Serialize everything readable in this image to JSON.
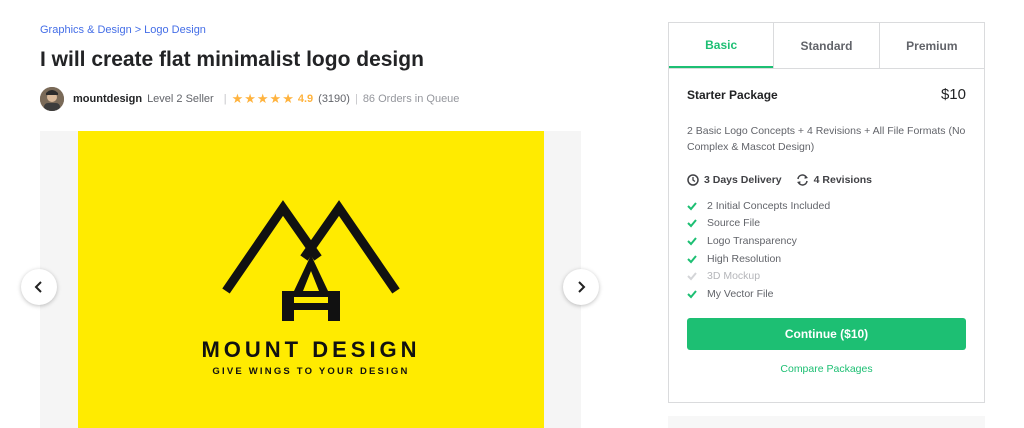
{
  "breadcrumb": {
    "category": "Graphics & Design",
    "separator": ">",
    "subcategory": "Logo Design"
  },
  "gig": {
    "title": "I will create flat minimalist logo design"
  },
  "seller": {
    "name": "mountdesign",
    "level": "Level 2 Seller",
    "rating": "4.9",
    "star_count": 5,
    "reviews": "(3190)",
    "queue": "86 Orders in Queue"
  },
  "gallery": {
    "brand_title": "MOUNT DESIGN",
    "brand_tagline": "GIVE WINGS TO YOUR DESIGN",
    "background_color": "#ffeb00",
    "prev_icon": "chevron-left-icon",
    "next_icon": "chevron-right-icon"
  },
  "package": {
    "tabs": [
      "Basic",
      "Standard",
      "Premium"
    ],
    "active_tab": "Basic",
    "name": "Starter Package",
    "price": "$10",
    "description": "2 Basic Logo Concepts + 4 Revisions + All File Formats (No Complex & Mascot Design)",
    "delivery": "3 Days Delivery",
    "revisions": "4 Revisions",
    "features": [
      {
        "label": "2 Initial Concepts Included",
        "included": true
      },
      {
        "label": "Source File",
        "included": true
      },
      {
        "label": "Logo Transparency",
        "included": true
      },
      {
        "label": "High Resolution",
        "included": true
      },
      {
        "label": "3D Mockup",
        "included": false
      },
      {
        "label": "My Vector File",
        "included": true
      }
    ],
    "continue_label": "Continue ($10)",
    "compare_label": "Compare Packages"
  },
  "colors": {
    "accent": "#1dbf73",
    "star": "#ffb33e",
    "link": "#446ee7"
  }
}
